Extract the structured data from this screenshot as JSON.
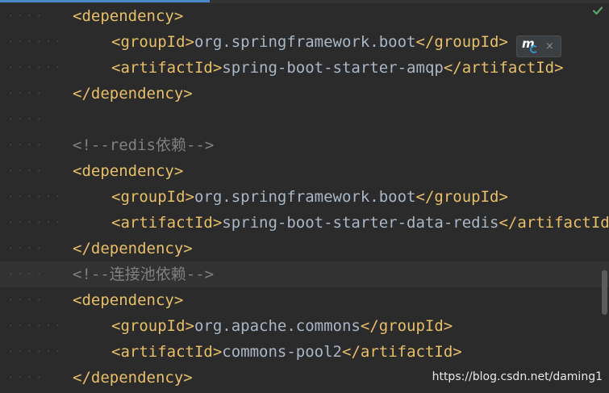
{
  "editor": {
    "lines": [
      {
        "tokens": [
          [
            "tag",
            "<dependency>"
          ]
        ]
      },
      {
        "tokens": [
          [
            "tag",
            "<groupId>"
          ],
          [
            "txt",
            "org.springframework.boot"
          ],
          [
            "tag",
            "</groupId>"
          ]
        ]
      },
      {
        "tokens": [
          [
            "tag",
            "<artifactId>"
          ],
          [
            "txt",
            "spring-boot-starter-amqp"
          ],
          [
            "tag",
            "</artifactId>"
          ]
        ]
      },
      {
        "tokens": [
          [
            "tag",
            "</dependency>"
          ]
        ]
      },
      {
        "tokens": []
      },
      {
        "tokens": [
          [
            "cmt",
            "<!--redis依赖-->"
          ]
        ]
      },
      {
        "tokens": [
          [
            "tag",
            "<dependency>"
          ]
        ]
      },
      {
        "tokens": [
          [
            "tag",
            "<groupId>"
          ],
          [
            "txt",
            "org.springframework.boot"
          ],
          [
            "tag",
            "</groupId>"
          ]
        ]
      },
      {
        "tokens": [
          [
            "tag",
            "<artifactId>"
          ],
          [
            "txt",
            "spring-boot-starter-data-redis"
          ],
          [
            "tag",
            "</artifactId>"
          ]
        ]
      },
      {
        "tokens": [
          [
            "tag",
            "</dependency>"
          ]
        ]
      },
      {
        "tokens": [
          [
            "cmt",
            "<!--连接池依赖-->"
          ]
        ]
      },
      {
        "tokens": [
          [
            "tag",
            "<dependency>"
          ]
        ]
      },
      {
        "tokens": [
          [
            "tag",
            "<groupId>"
          ],
          [
            "txt",
            "org.apache.commons"
          ],
          [
            "tag",
            "</groupId>"
          ]
        ]
      },
      {
        "tokens": [
          [
            "tag",
            "<artifactId>"
          ],
          [
            "txt",
            "commons-pool2"
          ],
          [
            "tag",
            "</artifactId>"
          ]
        ]
      },
      {
        "tokens": [
          [
            "tag",
            "</dependency>"
          ]
        ]
      }
    ],
    "highlighted_line": 10
  },
  "maven_popup": {
    "icon": "maven-reload-icon",
    "close_label": "×"
  },
  "status_icon": "checkmark-icon",
  "watermark": "https://blog.csdn.net/daming1",
  "colors": {
    "background": "#2b2b2b",
    "tag": "#e8bf6a",
    "text": "#a9b7c6",
    "comment": "#808080",
    "check": "#59a869",
    "maven_blue": "#3592c4"
  }
}
